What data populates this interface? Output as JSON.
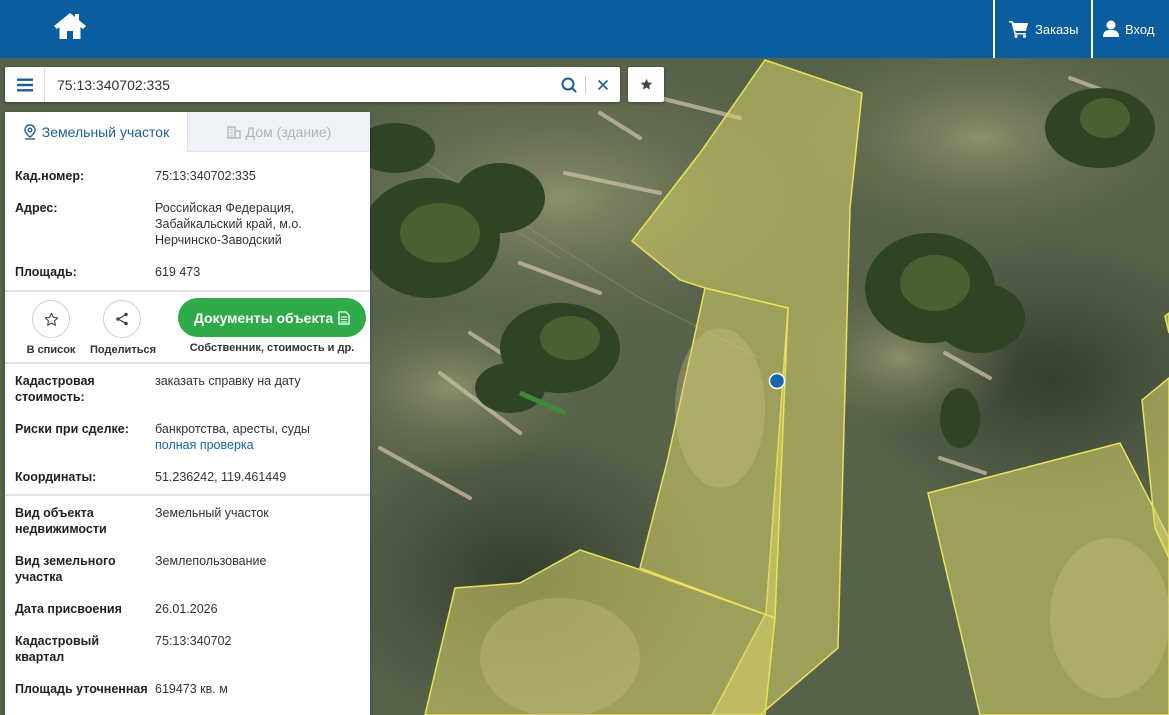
{
  "header": {
    "orders_label": "Заказы",
    "login_label": "Вход"
  },
  "search": {
    "value": "75:13:340702:335"
  },
  "tabs": [
    {
      "label": "Земельный участок",
      "active": true
    },
    {
      "label": "Дом (здание)",
      "active": false
    }
  ],
  "info": {
    "cad_number_label": "Кад.номер:",
    "cad_number_value": "75:13:340702:335",
    "address_label": "Адрес:",
    "address_value": "Российская Федерация, Забайкальский край, м.о. Нерчинско-Заводский",
    "area_label": "Площадь:",
    "area_value": "619 473"
  },
  "actions": {
    "add_list_label": "В список",
    "share_label": "Поделиться",
    "docs_label": "Документы объекта",
    "docs_sub": "Собственник, стоимость и др."
  },
  "details": {
    "cad_cost_label": "Кадастровая стоимость:",
    "cad_cost_link": "заказать справку на дату",
    "risks_label": "Риски при сделке:",
    "risks_value": "банкротства, аресты, суды",
    "risks_link": "полная проверка",
    "coords_label": "Координаты:",
    "coords_value": "51.236242, 119.461449",
    "object_type_label": "Вид объекта недвижимости",
    "object_type_value": "Земельный участок",
    "land_type_label": "Вид земельного участка",
    "land_type_value": "Землепользование",
    "date_label": "Дата присвоения",
    "date_value": "26.01.2026",
    "quarter_label": "Кадастровый квартал",
    "quarter_value": "75:13:340702",
    "area_precise_label": "Площадь уточненная",
    "area_precise_value": "619473 кв. м"
  },
  "colors": {
    "brand": "#0a5d9e",
    "accent_green": "#2eab48",
    "link": "#1a62a6",
    "parcel_fill": "#d8d36a",
    "parcel_stroke": "#e9e25a",
    "marker": "#1765b0"
  }
}
